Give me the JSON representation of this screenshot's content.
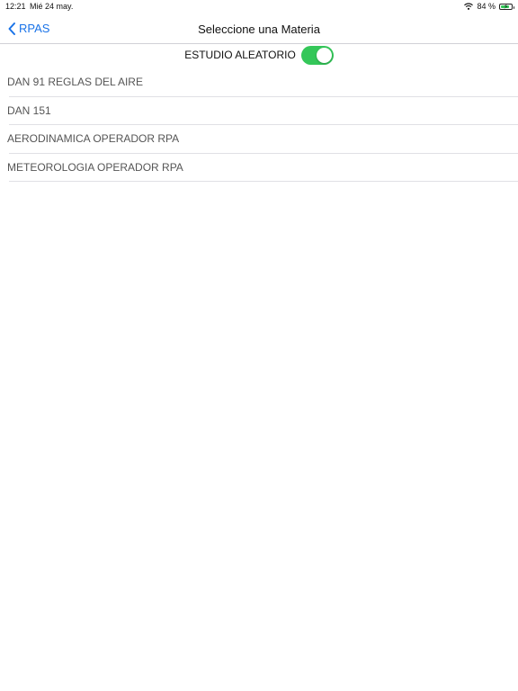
{
  "status_bar": {
    "time": "12:21",
    "date": "Mié 24 may.",
    "battery_text": "84 %",
    "battery_level": 0.84,
    "wifi_icon": "wifi-icon",
    "battery_icon": "battery-charging-icon"
  },
  "nav": {
    "back_label": "RPAS",
    "back_icon": "chevron-left-icon",
    "title": "Seleccione una Materia"
  },
  "random_study": {
    "label": "ESTUDIO ALEATORIO",
    "enabled": true
  },
  "subjects": [
    {
      "label": "DAN 91 REGLAS DEL AIRE"
    },
    {
      "label": "DAN 151"
    },
    {
      "label": "AERODINAMICA OPERADOR RPA"
    },
    {
      "label": "METEOROLOGIA OPERADOR RPA"
    }
  ],
  "colors": {
    "accent": "#1a73e8",
    "toggle_on": "#34c759",
    "separator": "#e0e0e5",
    "list_text": "#555555"
  }
}
